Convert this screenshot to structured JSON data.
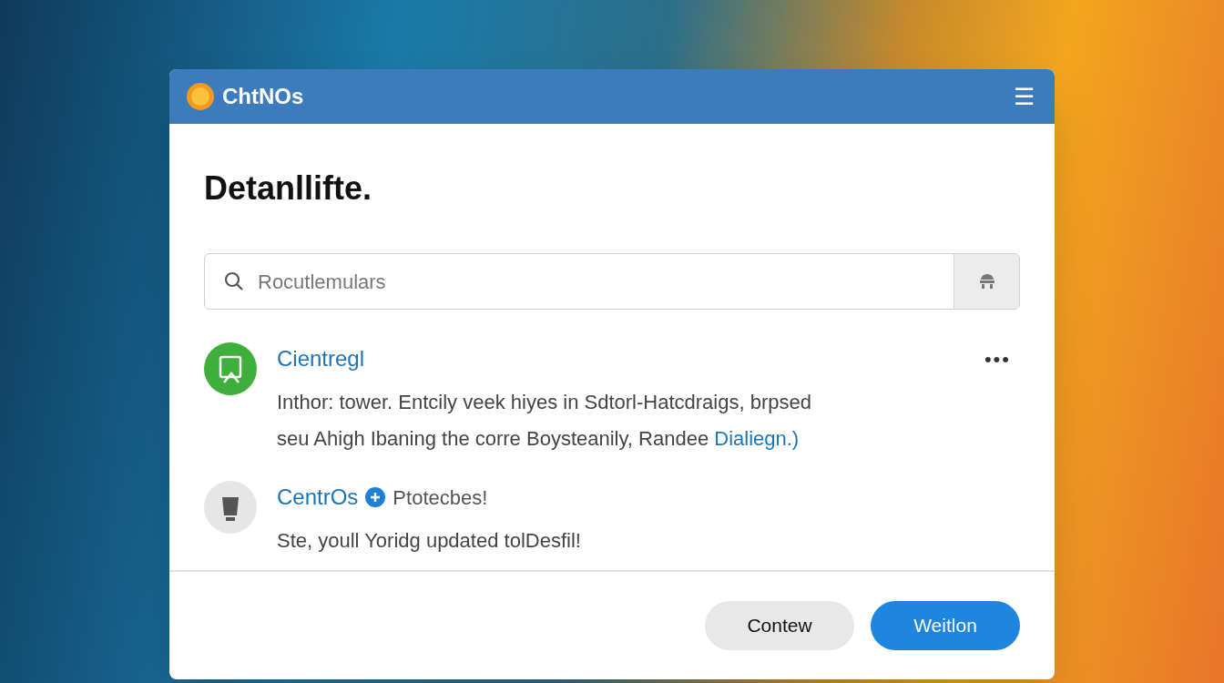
{
  "window": {
    "title": "ChtNOs",
    "menu": "☰"
  },
  "heading": "Detanllifte.",
  "search": {
    "placeholder": "Rocutlemulars"
  },
  "notifications": [
    {
      "kind": "app",
      "title": "Cientregl",
      "menu": "•••",
      "body": "Inthor: tower. Entcily veek hiyes in Sdtorl-Hatcdraigs, brpsed seu Ahigh Ibaning the corre Boysteanily, Randee",
      "link": "Dialiegn.)"
    },
    {
      "kind": "system",
      "title": "CentrOs",
      "badge": "Ptotecbes!",
      "body": "Ste, youll Yoridg updated tolDesfil!"
    }
  ],
  "buttons": [
    {
      "label": "Contew",
      "kind": "secondary"
    },
    {
      "label": "Weitlon",
      "kind": "primary"
    }
  ]
}
